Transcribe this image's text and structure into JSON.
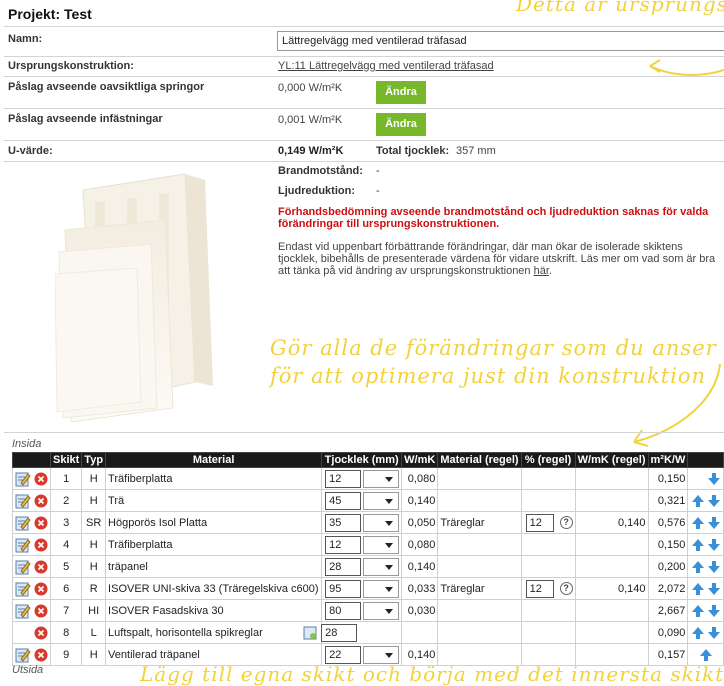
{
  "project_title": "Projekt: Test",
  "annotations": {
    "top": "Detta är ursprungs",
    "mid_line1": "Gör alla de förändringar som du anser nö",
    "mid_line2": "för att optimera just din konstruktion",
    "bottom": "Lägg till egna skikt och börja med det innersta skikt"
  },
  "fields": {
    "name_label": "Namn:",
    "name_value": "Lättregelvägg med ventilerad träfasad",
    "origin_label": "Ursprungskonstruktion:",
    "origin_link": "YL:11 Lättregelvägg med ventilerad träfasad",
    "gap_label": "Påslag avseende oavsiktliga springor",
    "gap_value": "0,000 W/m²K",
    "fix_label": "Påslag avseende infästningar",
    "fix_value": "0,001 W/m²K",
    "change_label": "Ändra",
    "u_label": "U-värde:",
    "u_value": "0,149 W/m²K",
    "thick_label": "Total tjocklek:",
    "thick_value": "357 mm",
    "fire_label": "Brandmotstånd:",
    "fire_value": "-",
    "sound_label": "Ljudreduktion:",
    "sound_value": "-",
    "warning": "Förhandsbedömning avseende brandmotstånd och ljudreduktion saknas för valda förändringar till ursprungskonstruktionen.",
    "info_text": "Endast vid uppenbart förbättrande förändringar, där man ökar de isolerade skiktens tjocklek, bibehålls de presenterade värdena för vidare utskrift. Läs mer om vad som är bra att tänka på vid ändring av ursprungskonstruktionen",
    "info_link": "här",
    "info_end": "."
  },
  "table": {
    "inside_label": "Insida",
    "outside_label": "Utsida",
    "headers": [
      "",
      "Skikt",
      "Typ",
      "Material",
      "Tjocklek (mm)",
      "W/mK",
      "Material (regel)",
      "% (regel)",
      "W/mK (regel)",
      "m²K/W",
      ""
    ],
    "rows": [
      {
        "n": "1",
        "typ": "H",
        "mat": "Träfiberplatta",
        "t": "12",
        "w": "0,080",
        "rm": "",
        "rp": "",
        "rw": "",
        "r": "0,150"
      },
      {
        "n": "2",
        "typ": "H",
        "mat": "Trä",
        "t": "45",
        "w": "0,140",
        "rm": "",
        "rp": "",
        "rw": "",
        "r": "0,321"
      },
      {
        "n": "3",
        "typ": "SR",
        "mat": "Högporös Isol Platta",
        "t": "35",
        "w": "0,050",
        "rm": "Träreglar",
        "rp": "12",
        "rw": "0,140",
        "r": "0,576"
      },
      {
        "n": "4",
        "typ": "H",
        "mat": "Träfiberplatta",
        "t": "12",
        "w": "0,080",
        "rm": "",
        "rp": "",
        "rw": "",
        "r": "0,150"
      },
      {
        "n": "5",
        "typ": "H",
        "mat": "träpanel",
        "t": "28",
        "w": "0,140",
        "rm": "",
        "rp": "",
        "rw": "",
        "r": "0,200"
      },
      {
        "n": "6",
        "typ": "R",
        "mat": "ISOVER UNI-skiva 33 (Träregelskiva c600)",
        "t": "95",
        "w": "0,033",
        "rm": "Träreglar",
        "rp": "12",
        "rw": "0,140",
        "r": "2,072"
      },
      {
        "n": "7",
        "typ": "HI",
        "mat": "ISOVER Fasadskiva 30",
        "t": "80",
        "w": "0,030",
        "rm": "",
        "rp": "",
        "rw": "",
        "r": "2,667"
      },
      {
        "n": "8",
        "typ": "L",
        "mat": "Luftspalt, horisontella spikreglar",
        "t": "28",
        "w": "",
        "rm": "",
        "rp": "",
        "rw": "",
        "r": "0,090"
      },
      {
        "n": "9",
        "typ": "H",
        "mat": "Ventilerad träpanel",
        "t": "22",
        "w": "0,140",
        "rm": "",
        "rp": "",
        "rw": "",
        "r": "0,157"
      }
    ]
  },
  "colors": {
    "accent_green": "#76b82a",
    "warning_red": "#cc1010",
    "arrow_blue": "#3a8fd9",
    "handwriting": "#f2d23c"
  }
}
